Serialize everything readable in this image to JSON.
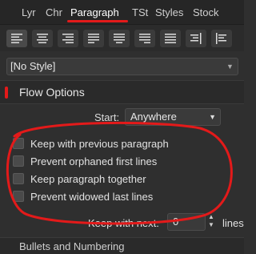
{
  "tabs": [
    {
      "label": "Lyr"
    },
    {
      "label": "Chr"
    },
    {
      "label": "Paragraph"
    },
    {
      "label": "TSt"
    },
    {
      "label": "Styles"
    },
    {
      "label": "Stock"
    }
  ],
  "active_tab": "Paragraph",
  "style_dropdown": {
    "value": "[No Style]"
  },
  "section": {
    "title": "Flow Options"
  },
  "start": {
    "label": "Start:",
    "value": "Anywhere"
  },
  "checkboxes": [
    {
      "label": "Keep with previous paragraph",
      "checked": false
    },
    {
      "label": "Prevent orphaned first lines",
      "checked": false
    },
    {
      "label": "Keep paragraph together",
      "checked": false
    },
    {
      "label": "Prevent widowed last lines",
      "checked": false
    }
  ],
  "keep_with_next": {
    "label": "Keep with next:",
    "value": "0",
    "unit": "lines"
  },
  "next_section": {
    "title": "Bullets and Numbering"
  },
  "colors": {
    "accent": "#e31a1a",
    "background": "#2f2f2f"
  },
  "alignment_icons": [
    "align-left-icon",
    "align-center-icon",
    "align-right-icon",
    "justify-left-icon",
    "justify-center-icon",
    "justify-right-icon",
    "justify-all-icon",
    "align-towards-spine-icon",
    "align-away-spine-icon"
  ]
}
